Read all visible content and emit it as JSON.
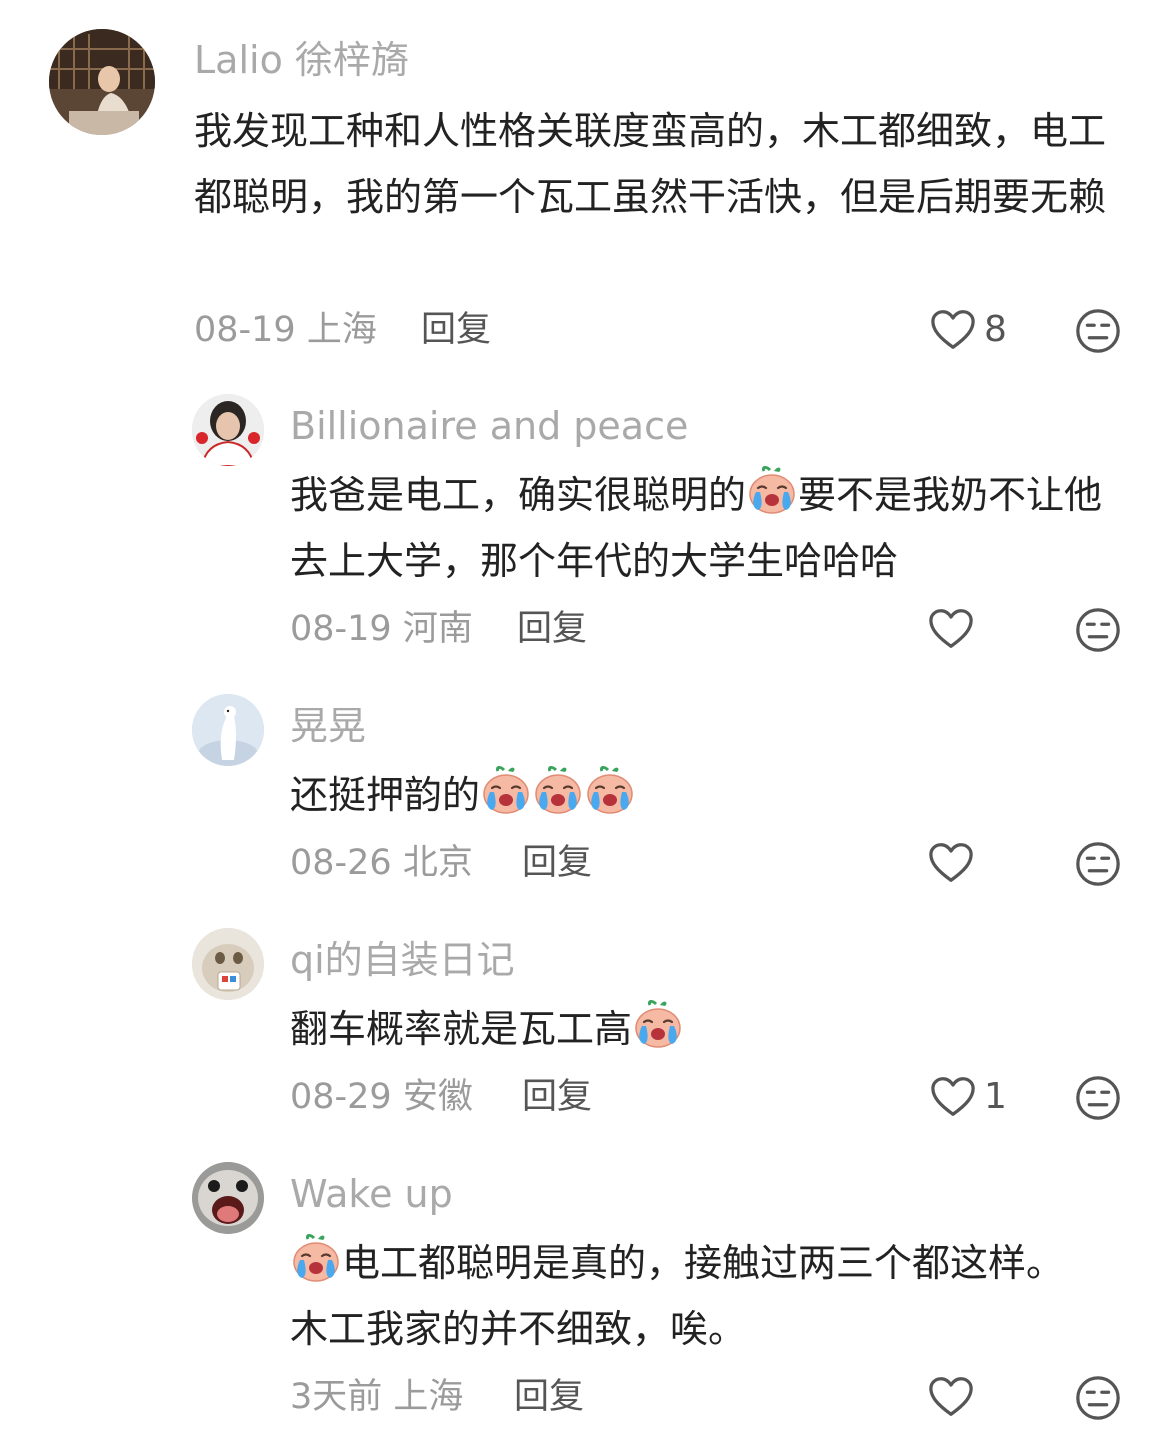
{
  "comments": [
    {
      "username": "Lalio 徐梓旖",
      "text": "我发现工种和人性格关联度蛮高的，木工都细致，电工都聪明，我的第一个瓦工虽然干活快，但是后期要无赖",
      "date": "08-19",
      "location": "上海",
      "reply_label": "回复",
      "likes": "8"
    },
    {
      "username": "Billionaire and peace",
      "text_before_emoji": "我爸是电工，确实很聪明的",
      "text_after_emoji": "要不是我奶不让他去上大学，那个年代的大学生哈哈哈",
      "date": "08-19",
      "location": "河南",
      "reply_label": "回复"
    },
    {
      "username": "晃晃",
      "text": "还挺押韵的",
      "date": "08-26",
      "location": "北京",
      "reply_label": "回复"
    },
    {
      "username": "qi的自装日记",
      "text": "翻车概率就是瓦工高",
      "date": "08-29",
      "location": "安徽",
      "reply_label": "回复",
      "likes": "1"
    },
    {
      "username": "Wake up",
      "text": "电工都聪明是真的，接触过两三个都这样。木工我家的并不细致，唉。",
      "date": "3天前",
      "location": "上海",
      "reply_label": "回复"
    }
  ],
  "icons": {
    "like": "heart-outline-icon",
    "dislike": "neutral-face-icon",
    "emoji": "crying-peach-emoji"
  },
  "colors": {
    "username": "#a9a9a9",
    "text": "#222222",
    "meta": "#9b9b9b",
    "icon": "#555555"
  }
}
